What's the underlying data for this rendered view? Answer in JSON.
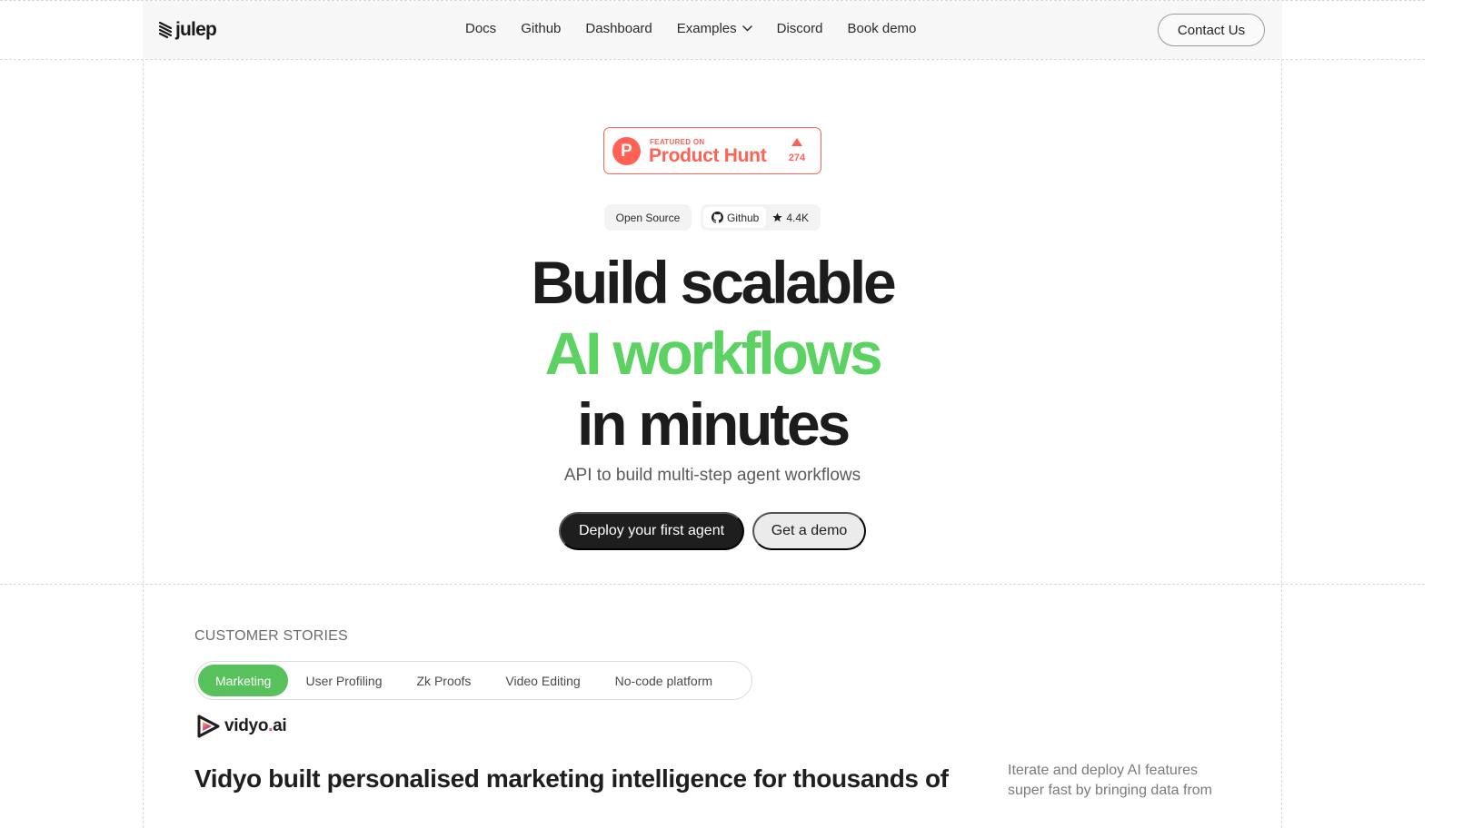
{
  "nav": {
    "logo_text": "julep",
    "links": [
      "Docs",
      "Github",
      "Dashboard",
      "Examples",
      "Discord",
      "Book demo"
    ],
    "contact_label": "Contact Us"
  },
  "product_hunt": {
    "featured_label": "FEATURED ON",
    "name": "Product Hunt",
    "logo_letter": "P",
    "upvotes": "274",
    "color": "#ff6154"
  },
  "chips": {
    "open_source": "Open Source",
    "github_label": "Github",
    "stars": "4.4K"
  },
  "hero": {
    "line1": "Build scalable",
    "line2": "AI workflows",
    "line3": "in minutes",
    "subtitle": "API to build multi-step agent workflows",
    "accent_color": "#5bd261"
  },
  "cta": {
    "primary": "Deploy your first agent",
    "secondary": "Get a demo"
  },
  "customer_stories": {
    "label": "CUSTOMER STORIES",
    "tabs": [
      "Marketing",
      "User Profiling",
      "Zk Proofs",
      "Video Editing",
      "No-code platform"
    ],
    "active_tab": "Marketing",
    "brand_name": "vidyo",
    "brand_dot": ".",
    "brand_suffix": "ai",
    "story_title": "Vidyo built personalised marketing intelligence for thousands of",
    "side_text": "Iterate and deploy AI features super fast by bringing data from"
  }
}
